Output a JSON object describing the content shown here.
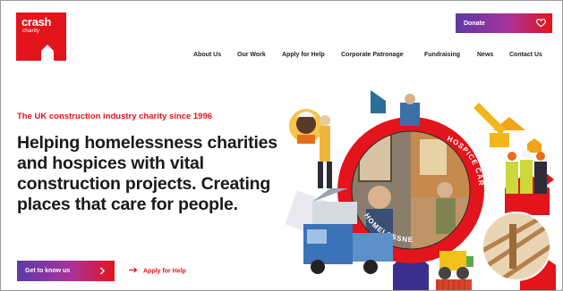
{
  "logo": {
    "brand": "crash",
    "sub": "charity"
  },
  "donate": {
    "label": "Donate"
  },
  "nav": {
    "items": [
      "About Us",
      "Our Work",
      "Apply for Help",
      "Corporate Patronage",
      "Fundraising",
      "News",
      "Contact Us"
    ]
  },
  "hero": {
    "tagline": "The UK construction industry charity since 1996",
    "headline": "Helping homelessness charities and hospices with vital construction projects. Creating places that care for people.",
    "cta_label": "Get to know us",
    "apply_label": "Apply for Help"
  },
  "collage": {
    "ring_label_left": "HOMELESSNESS",
    "ring_label_right": "HOSPICE CARE"
  },
  "colors": {
    "brand_red": "#e3141b",
    "brand_purple": "#5b3aa8",
    "brand_magenta": "#a9329a"
  }
}
